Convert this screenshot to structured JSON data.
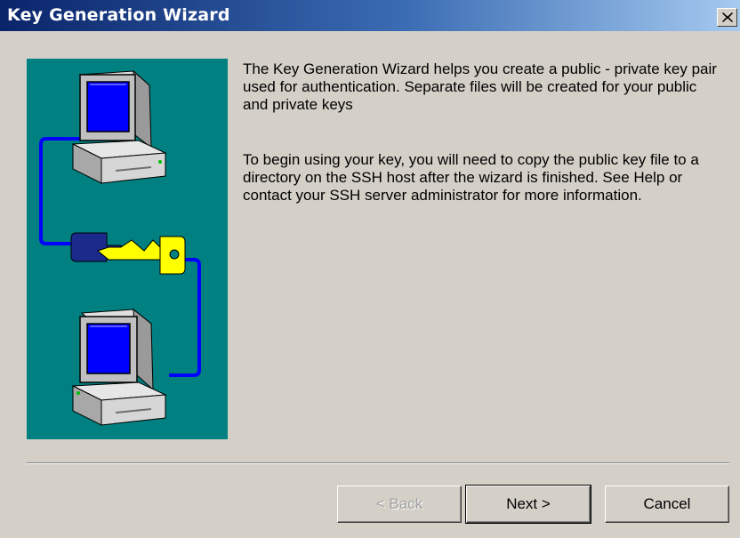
{
  "window": {
    "title": "Key Generation Wizard",
    "close_icon": "close-icon"
  },
  "content": {
    "paragraph1": "The Key Generation Wizard helps you create a public - private key pair used for authentication. Separate files will be created for your public and private keys",
    "paragraph2": "To begin using your key, you will need to copy the public key file to a directory on the SSH host after the wizard is finished. See Help or contact your SSH server administrator for more information."
  },
  "illustration": {
    "icons": [
      "computer-icon",
      "key-icon",
      "computer-icon"
    ]
  },
  "buttons": {
    "back": "< Back",
    "next": "Next >",
    "cancel": "Cancel"
  },
  "colors": {
    "titlebar_start": "#0a246a",
    "titlebar_end": "#a6caf0",
    "panel_bg": "#008080",
    "dialog_bg": "#d4d0c8",
    "key_left": "#1c2a8c",
    "key_right": "#ffff00",
    "cable": "#0000ff"
  }
}
